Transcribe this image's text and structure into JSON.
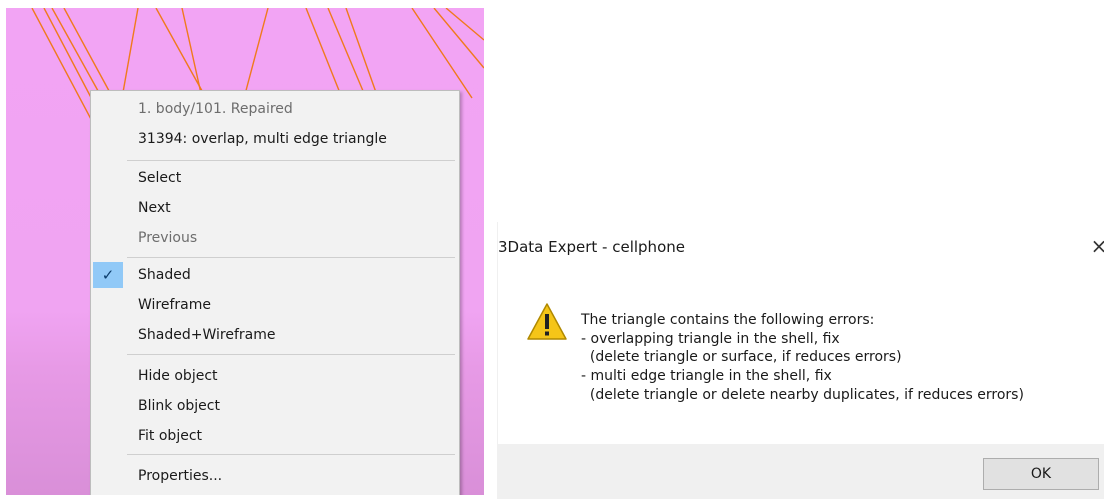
{
  "context_menu": {
    "header": [
      "1. body/101. Repaired",
      "31394: overlap, multi edge triangle"
    ],
    "groups": [
      [
        {
          "label": "Select",
          "enabled": true
        },
        {
          "label": "Next",
          "enabled": true
        },
        {
          "label": "Previous",
          "enabled": false
        }
      ],
      [
        {
          "label": "Shaded",
          "checked": true
        },
        {
          "label": "Wireframe"
        },
        {
          "label": "Shaded+Wireframe"
        }
      ],
      [
        {
          "label": "Hide object"
        },
        {
          "label": "Blink object"
        },
        {
          "label": "Fit object"
        }
      ],
      [
        {
          "label": "Properties..."
        }
      ]
    ],
    "check_icon": "check-icon"
  },
  "dialog": {
    "title": "3Data Expert - cellphone",
    "close_glyph": "×",
    "icon": "warning-icon",
    "message": "The triangle contains the following errors:\n- overlapping triangle in the shell, fix\n  (delete triangle or surface, if reduces errors)\n- multi edge triangle in the shell, fix\n  (delete triangle or delete nearby duplicates, if reduces errors)",
    "ok_label": "OK"
  },
  "colors": {
    "viewport_bg": "#f0a4f2",
    "wire_lines": "#f07a1c",
    "menu_bg": "#f2f2f2",
    "check_highlight": "#91c9f7",
    "dialog_footer": "#f0f0f0"
  }
}
